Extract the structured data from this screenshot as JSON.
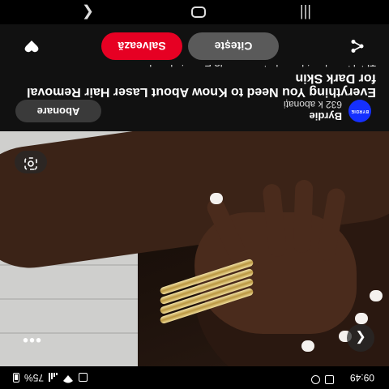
{
  "status_bar": {
    "time": "09:49",
    "battery": "75%"
  },
  "photo": {
    "back_icon": "chevron-left-icon",
    "more_icon": "more-dots-icon",
    "lens_icon": "visual-search-icon"
  },
  "creator": {
    "name": "Byrdie",
    "followers": "632 k abonați",
    "avatar_text": "BYRDIE",
    "subscribe_label": "Abonare"
  },
  "pin": {
    "title": "Everything You Need to Know About Laser Hair Removal for Dark Skin",
    "description": "Thinking about laser hair removal? Experts break"
  },
  "actions": {
    "read_label": "Citește",
    "save_label": "Salvează",
    "save_color": "#e60023"
  },
  "colors": {
    "accent": "#e60023",
    "avatar_bg": "#1530ff"
  }
}
